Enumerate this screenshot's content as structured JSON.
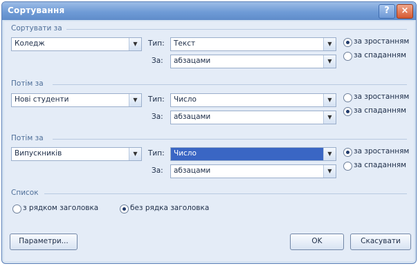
{
  "window": {
    "title": "Сортування",
    "help_icon": "?",
    "close_icon": "×"
  },
  "sort1": {
    "section": "Сортувати за",
    "field": "Коледж",
    "type_label": "Тип:",
    "type_value": "Текст",
    "by_label": "За:",
    "by_value": "абзацами",
    "asc": "за зростанням",
    "desc": "за спаданням",
    "selected": "asc"
  },
  "sort2": {
    "section": "Потім за",
    "field": "Нові студенти",
    "type_label": "Тип:",
    "type_value": "Число",
    "by_label": "За:",
    "by_value": "абзацами",
    "asc": "за зростанням",
    "desc": "за спаданням",
    "selected": "desc"
  },
  "sort3": {
    "section": "Потім за",
    "field": "Випускників",
    "type_label": "Тип:",
    "type_value": "Число",
    "by_label": "За:",
    "by_value": "абзацами",
    "asc": "за зростанням",
    "desc": "за спаданням",
    "selected": "asc"
  },
  "list": {
    "section": "Список",
    "with_header": "з рядком заголовка",
    "without_header": "без рядка заголовка",
    "selected": "without_header"
  },
  "buttons": {
    "params": "Параметри...",
    "ok": "OK",
    "cancel": "Скасувати"
  }
}
